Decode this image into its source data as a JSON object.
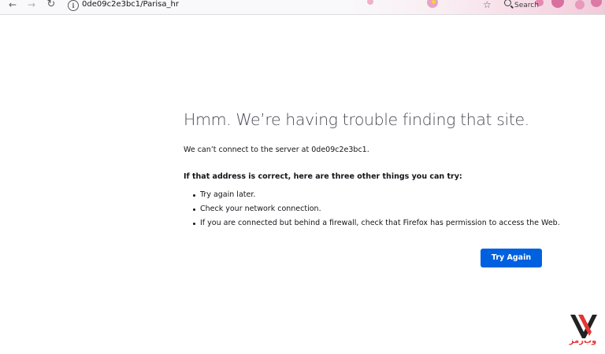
{
  "browser": {
    "url": "0de09c2e3bc1/Parisa_hr",
    "search_label": "Search",
    "icons": {
      "back": "back-arrow-icon",
      "forward": "forward-arrow-icon",
      "reload": "reload-icon",
      "info": "site-info-icon",
      "bookmark": "star-icon",
      "search": "search-icon"
    }
  },
  "error_page": {
    "title": "Hmm. We’re having trouble finding that site.",
    "subtitle": "We can’t connect to the server at 0de09c2e3bc1.",
    "advice_heading": "If that address is correct, here are three other things you can try:",
    "tips": [
      "Try again later.",
      "Check your network connection.",
      "If you are connected but behind a firewall, check that Firefox has permission to access the Web."
    ],
    "try_again_label": "Try Again"
  },
  "watermark": {
    "text": "وب‌رمز",
    "color": "#e33636"
  },
  "colors": {
    "accent": "#0061e0",
    "toolbar_bg": "#f9f9fb",
    "title_text": "#4a4a55"
  }
}
